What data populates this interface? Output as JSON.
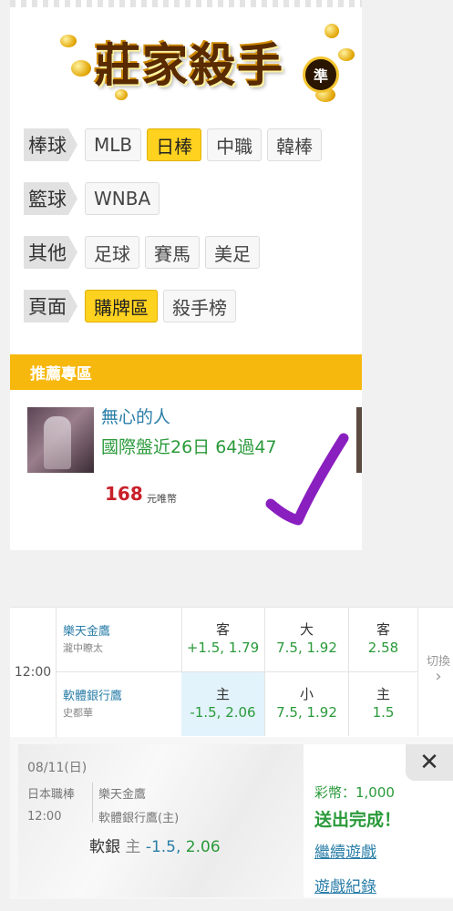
{
  "logo": {
    "title": "莊家殺手",
    "badge": "準"
  },
  "menu": {
    "baseball": {
      "label": "棒球",
      "items": [
        "MLB",
        "日棒",
        "中職",
        "韓棒"
      ],
      "active": "日棒"
    },
    "basketball": {
      "label": "籃球",
      "items": [
        "WNBA"
      ]
    },
    "other": {
      "label": "其他",
      "items": [
        "足球",
        "賽馬",
        "美足"
      ]
    },
    "page": {
      "label": "頁面",
      "items": [
        "購牌區",
        "殺手榜"
      ],
      "active": "購牌區"
    }
  },
  "recommend": {
    "header": "推薦專區",
    "tipster_name": "無心的人",
    "record": "國際盤近26日 64過47",
    "price": "168",
    "price_unit": "元唯幣"
  },
  "match": {
    "time": "12:00",
    "away": {
      "team": "樂天金鷹",
      "pitcher": "瀧中瞭太"
    },
    "home": {
      "team": "軟體銀行鷹",
      "pitcher": "史都華"
    },
    "odds": {
      "away_spread_label": "客",
      "away_spread": "+1.5, 1.79",
      "over_label": "大",
      "over": "7.5, 1.92",
      "away_ml_label": "客",
      "away_ml": "2.58",
      "home_spread_label": "主",
      "home_spread": "-1.5, 2.06",
      "under_label": "小",
      "under": "7.5, 1.92",
      "home_ml_label": "主",
      "home_ml": "1.5"
    },
    "switch_label": "切換",
    "switch_arrow": "›"
  },
  "confirmation": {
    "date": "08/11(日)",
    "league": "日本職棒",
    "time": "12:00",
    "team1": "樂天金鷹",
    "team2": "軟體銀行鷹(主)",
    "bet_team": "軟銀",
    "bet_side": "主",
    "bet_line": "-1.5,",
    "bet_odds": "2.06",
    "coins": "彩幣：1,000",
    "status": "送出完成！",
    "continue_link": "繼續遊戲",
    "history_link": "遊戲紀錄",
    "close": "✕"
  },
  "colors": {
    "accent_yellow": "#ffd21f",
    "bar_orange": "#f7b80e",
    "link_blue": "#2a7ea8",
    "odds_green": "#2a9a3a",
    "price_red": "#c8202a",
    "check_purple": "#8a1fc0"
  }
}
